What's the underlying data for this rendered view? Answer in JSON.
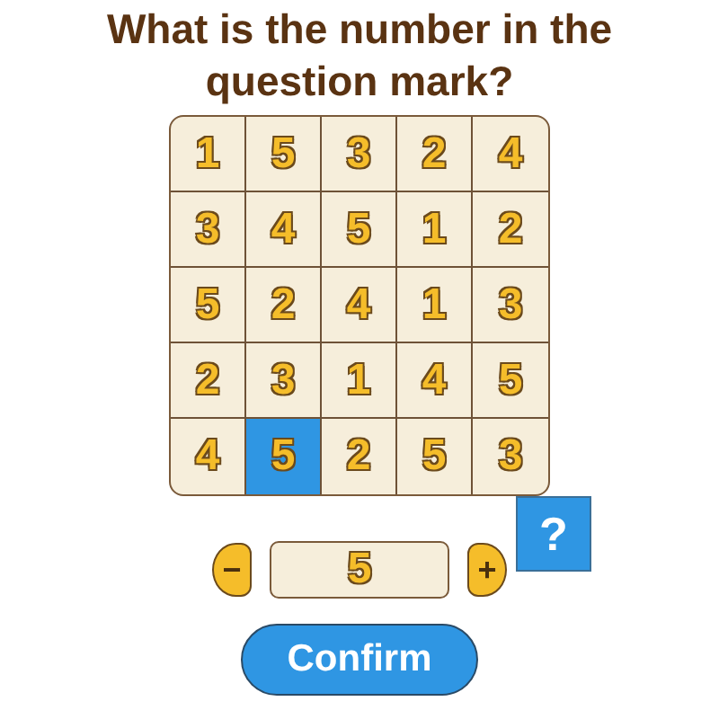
{
  "title": "What is the number in the question mark?",
  "grid": [
    [
      {
        "value": "1",
        "selected": false
      },
      {
        "value": "5",
        "selected": false
      },
      {
        "value": "3",
        "selected": false
      },
      {
        "value": "2",
        "selected": false
      },
      {
        "value": "4",
        "selected": false
      }
    ],
    [
      {
        "value": "3",
        "selected": false
      },
      {
        "value": "4",
        "selected": false
      },
      {
        "value": "5",
        "selected": false
      },
      {
        "value": "1",
        "selected": false
      },
      {
        "value": "2",
        "selected": false
      }
    ],
    [
      {
        "value": "5",
        "selected": false
      },
      {
        "value": "2",
        "selected": false
      },
      {
        "value": "4",
        "selected": false
      },
      {
        "value": "1",
        "selected": false
      },
      {
        "value": "3",
        "selected": false
      }
    ],
    [
      {
        "value": "2",
        "selected": false
      },
      {
        "value": "3",
        "selected": false
      },
      {
        "value": "1",
        "selected": false
      },
      {
        "value": "4",
        "selected": false
      },
      {
        "value": "5",
        "selected": false
      }
    ],
    [
      {
        "value": "4",
        "selected": false
      },
      {
        "value": "5",
        "selected": true
      },
      {
        "value": "2",
        "selected": false
      },
      {
        "value": "5",
        "selected": false
      },
      {
        "value": "3",
        "selected": false
      }
    ]
  ],
  "question_tile": "?",
  "stepper": {
    "decrement": "−",
    "value": "5",
    "increment": "+"
  },
  "confirm_button": "Confirm"
}
